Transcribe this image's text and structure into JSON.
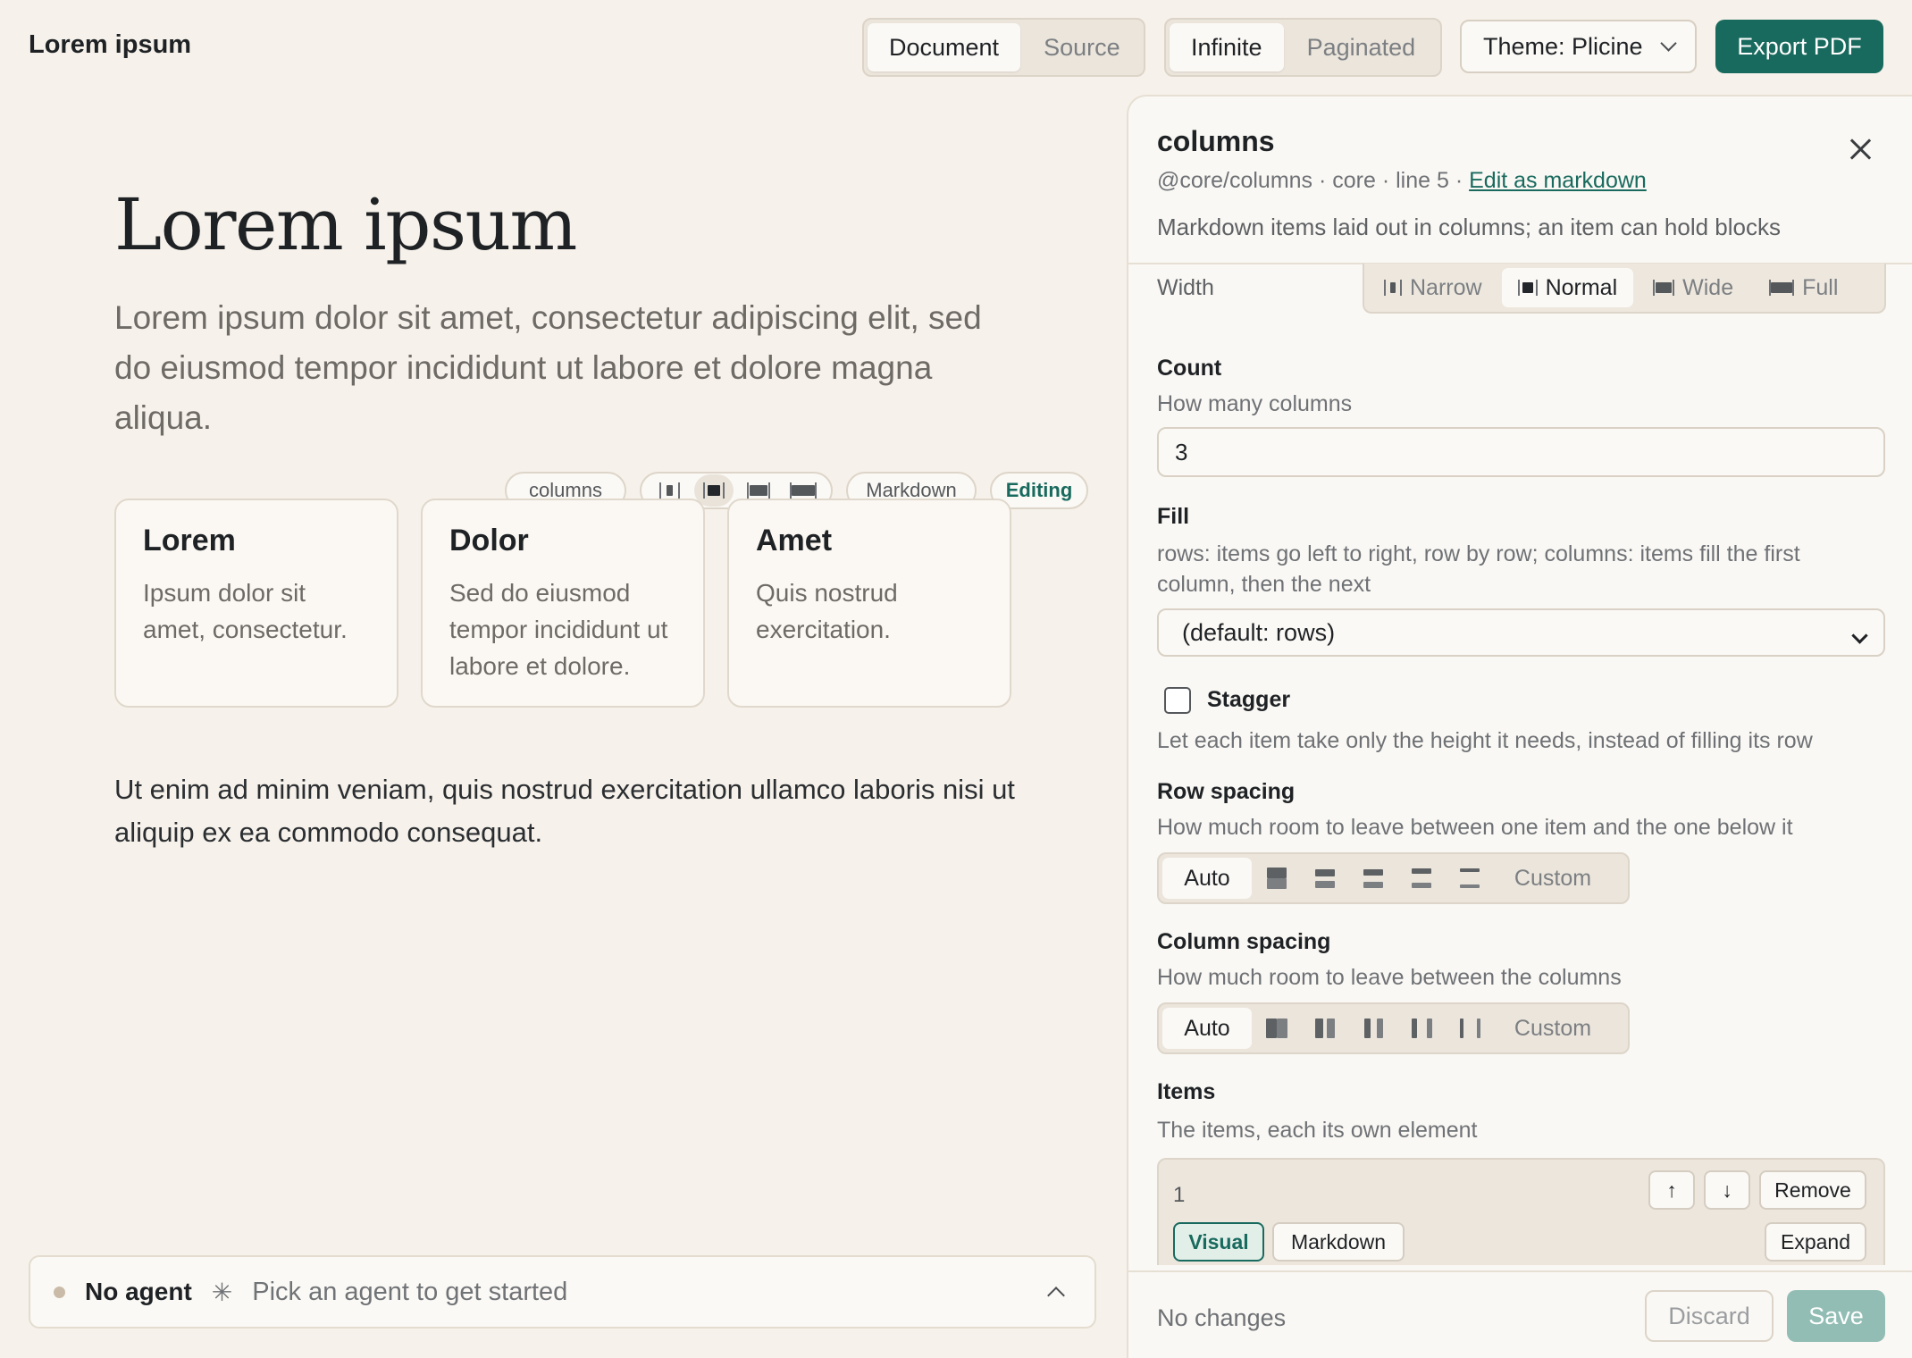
{
  "header": {
    "app_title": "Lorem ipsum",
    "view_tabs": [
      {
        "label": "Document",
        "active": true
      },
      {
        "label": "Source",
        "active": false
      }
    ],
    "layout_tabs": [
      {
        "label": "Infinite",
        "active": true
      },
      {
        "label": "Paginated",
        "active": false
      }
    ],
    "theme_label": "Theme: Plicine",
    "export_label": "Export PDF"
  },
  "document": {
    "title": "Lorem ipsum",
    "lead": "Lorem ipsum dolor sit amet, consectetur adipiscing elit, sed do eiusmod tempor incididunt ut labore et dolore magna aliqua.",
    "block_toolbar": {
      "block_name": "columns",
      "markdown_label": "Markdown",
      "editing_label": "Editing"
    },
    "cards": [
      {
        "title": "Lorem",
        "text": "Ipsum dolor sit amet, consectetur."
      },
      {
        "title": "Dolor",
        "text": "Sed do eiusmod tempor incididunt ut labore et dolore."
      },
      {
        "title": "Amet",
        "text": "Quis nostrud exercitation."
      }
    ],
    "paragraph": "Ut enim ad minim veniam, quis nostrud exercitation ullamco laboris nisi ut aliquip ex ea commodo consequat."
  },
  "agent_bar": {
    "name": "No agent",
    "hint": "Pick an agent to get started"
  },
  "panel": {
    "title": "columns",
    "meta": "@core/columns · core · line 5 · ",
    "edit_link": "Edit as markdown",
    "description": "Markdown items laid out in columns; an item can hold blocks",
    "width": {
      "label": "Width",
      "options": [
        {
          "label": "Narrow",
          "active": false
        },
        {
          "label": "Normal",
          "active": true
        },
        {
          "label": "Wide",
          "active": false
        },
        {
          "label": "Full",
          "active": false
        }
      ]
    },
    "count": {
      "label": "Count",
      "help": "How many columns",
      "value": "3"
    },
    "fill": {
      "label": "Fill",
      "help": "rows: items go left to right, row by row; columns: items fill the first column, then the next",
      "selected": "(default: rows)"
    },
    "stagger": {
      "label": "Stagger",
      "help": "Let each item take only the height it needs, instead of filling its row",
      "checked": false
    },
    "row_spacing": {
      "label": "Row spacing",
      "help": "How much room to leave between one item and the one below it",
      "auto_label": "Auto",
      "custom_label": "Custom"
    },
    "column_spacing": {
      "label": "Column spacing",
      "help": "How much room to leave between the columns",
      "auto_label": "Auto",
      "custom_label": "Custom"
    },
    "items": {
      "label": "Items",
      "help": "The items, each its own element",
      "first_item_number": "1",
      "remove_label": "Remove",
      "visual_label": "Visual",
      "markdown_label": "Markdown",
      "expand_label": "Expand"
    },
    "footer": {
      "status": "No changes",
      "discard_label": "Discard",
      "save_label": "Save"
    }
  },
  "colors": {
    "accent": "#196a5e",
    "background": "#f6f1ea",
    "panel": "#faf8f4"
  }
}
